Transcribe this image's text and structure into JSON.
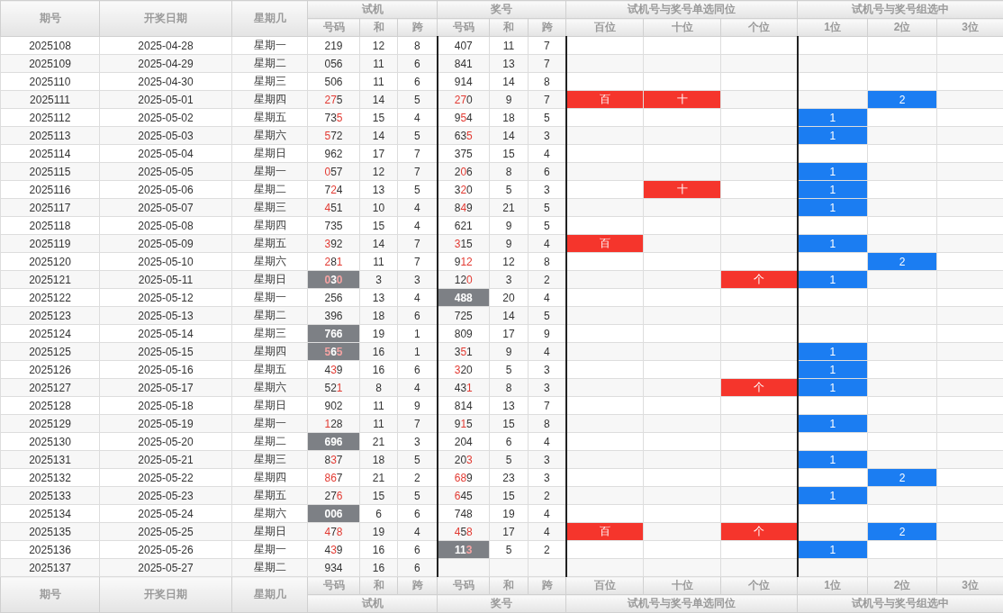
{
  "header": {
    "columns": [
      "期号",
      "开奖日期",
      "星期几"
    ],
    "groups": [
      {
        "title": "试机",
        "subs": [
          "号码",
          "和",
          "跨"
        ]
      },
      {
        "title": "奖号",
        "subs": [
          "号码",
          "和",
          "跨"
        ]
      },
      {
        "title": "试机号与奖号单选同位",
        "subs": [
          "百位",
          "十位",
          "个位"
        ]
      },
      {
        "title": "试机号与奖号组选中",
        "subs": [
          "1位",
          "2位",
          "3位"
        ]
      }
    ]
  },
  "rows": [
    {
      "issue": "2025108",
      "date": "2025-04-28",
      "weekday": "星期一",
      "trial": {
        "number": "219",
        "hits": [
          false,
          false,
          false
        ],
        "shaded": false,
        "sum": "12",
        "span": "8"
      },
      "draw": {
        "number": "407",
        "hits": [
          false,
          false,
          false
        ],
        "shaded": false,
        "sum": "11",
        "span": "7"
      },
      "same_position": {},
      "group_hit": {}
    },
    {
      "issue": "2025109",
      "date": "2025-04-29",
      "weekday": "星期二",
      "trial": {
        "number": "056",
        "hits": [
          false,
          false,
          false
        ],
        "shaded": false,
        "sum": "11",
        "span": "6"
      },
      "draw": {
        "number": "841",
        "hits": [
          false,
          false,
          false
        ],
        "shaded": false,
        "sum": "13",
        "span": "7"
      },
      "same_position": {},
      "group_hit": {}
    },
    {
      "issue": "2025110",
      "date": "2025-04-30",
      "weekday": "星期三",
      "trial": {
        "number": "506",
        "hits": [
          false,
          false,
          false
        ],
        "shaded": false,
        "sum": "11",
        "span": "6"
      },
      "draw": {
        "number": "914",
        "hits": [
          false,
          false,
          false
        ],
        "shaded": false,
        "sum": "14",
        "span": "8"
      },
      "same_position": {},
      "group_hit": {}
    },
    {
      "issue": "2025111",
      "date": "2025-05-01",
      "weekday": "星期四",
      "trial": {
        "number": "275",
        "hits": [
          true,
          true,
          false
        ],
        "shaded": false,
        "sum": "14",
        "span": "5"
      },
      "draw": {
        "number": "270",
        "hits": [
          true,
          true,
          false
        ],
        "shaded": false,
        "sum": "9",
        "span": "7"
      },
      "same_position": {
        "hundreds": "百",
        "tens": "十"
      },
      "group_hit": {
        "second": "2"
      }
    },
    {
      "issue": "2025112",
      "date": "2025-05-02",
      "weekday": "星期五",
      "trial": {
        "number": "735",
        "hits": [
          false,
          false,
          true
        ],
        "shaded": false,
        "sum": "15",
        "span": "4"
      },
      "draw": {
        "number": "954",
        "hits": [
          false,
          true,
          false
        ],
        "shaded": false,
        "sum": "18",
        "span": "5"
      },
      "same_position": {},
      "group_hit": {
        "first": "1"
      }
    },
    {
      "issue": "2025113",
      "date": "2025-05-03",
      "weekday": "星期六",
      "trial": {
        "number": "572",
        "hits": [
          true,
          false,
          false
        ],
        "shaded": false,
        "sum": "14",
        "span": "5"
      },
      "draw": {
        "number": "635",
        "hits": [
          false,
          false,
          true
        ],
        "shaded": false,
        "sum": "14",
        "span": "3"
      },
      "same_position": {},
      "group_hit": {
        "first": "1"
      }
    },
    {
      "issue": "2025114",
      "date": "2025-05-04",
      "weekday": "星期日",
      "trial": {
        "number": "962",
        "hits": [
          false,
          false,
          false
        ],
        "shaded": false,
        "sum": "17",
        "span": "7"
      },
      "draw": {
        "number": "375",
        "hits": [
          false,
          false,
          false
        ],
        "shaded": false,
        "sum": "15",
        "span": "4"
      },
      "same_position": {},
      "group_hit": {}
    },
    {
      "issue": "2025115",
      "date": "2025-05-05",
      "weekday": "星期一",
      "trial": {
        "number": "057",
        "hits": [
          true,
          false,
          false
        ],
        "shaded": false,
        "sum": "12",
        "span": "7"
      },
      "draw": {
        "number": "206",
        "hits": [
          false,
          true,
          false
        ],
        "shaded": false,
        "sum": "8",
        "span": "6"
      },
      "same_position": {},
      "group_hit": {
        "first": "1"
      }
    },
    {
      "issue": "2025116",
      "date": "2025-05-06",
      "weekday": "星期二",
      "trial": {
        "number": "724",
        "hits": [
          false,
          true,
          false
        ],
        "shaded": false,
        "sum": "13",
        "span": "5"
      },
      "draw": {
        "number": "320",
        "hits": [
          false,
          true,
          false
        ],
        "shaded": false,
        "sum": "5",
        "span": "3"
      },
      "same_position": {
        "tens": "十"
      },
      "group_hit": {
        "first": "1"
      }
    },
    {
      "issue": "2025117",
      "date": "2025-05-07",
      "weekday": "星期三",
      "trial": {
        "number": "451",
        "hits": [
          true,
          false,
          false
        ],
        "shaded": false,
        "sum": "10",
        "span": "4"
      },
      "draw": {
        "number": "849",
        "hits": [
          false,
          true,
          false
        ],
        "shaded": false,
        "sum": "21",
        "span": "5"
      },
      "same_position": {},
      "group_hit": {
        "first": "1"
      }
    },
    {
      "issue": "2025118",
      "date": "2025-05-08",
      "weekday": "星期四",
      "trial": {
        "number": "735",
        "hits": [
          false,
          false,
          false
        ],
        "shaded": false,
        "sum": "15",
        "span": "4"
      },
      "draw": {
        "number": "621",
        "hits": [
          false,
          false,
          false
        ],
        "shaded": false,
        "sum": "9",
        "span": "5"
      },
      "same_position": {},
      "group_hit": {}
    },
    {
      "issue": "2025119",
      "date": "2025-05-09",
      "weekday": "星期五",
      "trial": {
        "number": "392",
        "hits": [
          true,
          false,
          false
        ],
        "shaded": false,
        "sum": "14",
        "span": "7"
      },
      "draw": {
        "number": "315",
        "hits": [
          true,
          false,
          false
        ],
        "shaded": false,
        "sum": "9",
        "span": "4"
      },
      "same_position": {
        "hundreds": "百"
      },
      "group_hit": {
        "first": "1"
      }
    },
    {
      "issue": "2025120",
      "date": "2025-05-10",
      "weekday": "星期六",
      "trial": {
        "number": "281",
        "hits": [
          true,
          false,
          true
        ],
        "shaded": false,
        "sum": "11",
        "span": "7"
      },
      "draw": {
        "number": "912",
        "hits": [
          false,
          true,
          true
        ],
        "shaded": false,
        "sum": "12",
        "span": "8"
      },
      "same_position": {},
      "group_hit": {
        "second": "2"
      }
    },
    {
      "issue": "2025121",
      "date": "2025-05-11",
      "weekday": "星期日",
      "trial": {
        "number": "030",
        "hits": [
          true,
          false,
          true
        ],
        "shaded": true,
        "sum": "3",
        "span": "3"
      },
      "draw": {
        "number": "120",
        "hits": [
          false,
          false,
          true
        ],
        "shaded": false,
        "sum": "3",
        "span": "2"
      },
      "same_position": {
        "units": "个"
      },
      "group_hit": {
        "first": "1"
      }
    },
    {
      "issue": "2025122",
      "date": "2025-05-12",
      "weekday": "星期一",
      "trial": {
        "number": "256",
        "hits": [
          false,
          false,
          false
        ],
        "shaded": false,
        "sum": "13",
        "span": "4"
      },
      "draw": {
        "number": "488",
        "hits": [
          false,
          false,
          false
        ],
        "shaded": true,
        "sum": "20",
        "span": "4"
      },
      "same_position": {},
      "group_hit": {}
    },
    {
      "issue": "2025123",
      "date": "2025-05-13",
      "weekday": "星期二",
      "trial": {
        "number": "396",
        "hits": [
          false,
          false,
          false
        ],
        "shaded": false,
        "sum": "18",
        "span": "6"
      },
      "draw": {
        "number": "725",
        "hits": [
          false,
          false,
          false
        ],
        "shaded": false,
        "sum": "14",
        "span": "5"
      },
      "same_position": {},
      "group_hit": {}
    },
    {
      "issue": "2025124",
      "date": "2025-05-14",
      "weekday": "星期三",
      "trial": {
        "number": "766",
        "hits": [
          false,
          false,
          false
        ],
        "shaded": true,
        "sum": "19",
        "span": "1"
      },
      "draw": {
        "number": "809",
        "hits": [
          false,
          false,
          false
        ],
        "shaded": false,
        "sum": "17",
        "span": "9"
      },
      "same_position": {},
      "group_hit": {}
    },
    {
      "issue": "2025125",
      "date": "2025-05-15",
      "weekday": "星期四",
      "trial": {
        "number": "565",
        "hits": [
          true,
          false,
          true
        ],
        "shaded": true,
        "sum": "16",
        "span": "1"
      },
      "draw": {
        "number": "351",
        "hits": [
          false,
          true,
          false
        ],
        "shaded": false,
        "sum": "9",
        "span": "4"
      },
      "same_position": {},
      "group_hit": {
        "first": "1"
      }
    },
    {
      "issue": "2025126",
      "date": "2025-05-16",
      "weekday": "星期五",
      "trial": {
        "number": "439",
        "hits": [
          false,
          true,
          false
        ],
        "shaded": false,
        "sum": "16",
        "span": "6"
      },
      "draw": {
        "number": "320",
        "hits": [
          true,
          false,
          false
        ],
        "shaded": false,
        "sum": "5",
        "span": "3"
      },
      "same_position": {},
      "group_hit": {
        "first": "1"
      }
    },
    {
      "issue": "2025127",
      "date": "2025-05-17",
      "weekday": "星期六",
      "trial": {
        "number": "521",
        "hits": [
          false,
          false,
          true
        ],
        "shaded": false,
        "sum": "8",
        "span": "4"
      },
      "draw": {
        "number": "431",
        "hits": [
          false,
          false,
          true
        ],
        "shaded": false,
        "sum": "8",
        "span": "3"
      },
      "same_position": {
        "units": "个"
      },
      "group_hit": {
        "first": "1"
      }
    },
    {
      "issue": "2025128",
      "date": "2025-05-18",
      "weekday": "星期日",
      "trial": {
        "number": "902",
        "hits": [
          false,
          false,
          false
        ],
        "shaded": false,
        "sum": "11",
        "span": "9"
      },
      "draw": {
        "number": "814",
        "hits": [
          false,
          false,
          false
        ],
        "shaded": false,
        "sum": "13",
        "span": "7"
      },
      "same_position": {},
      "group_hit": {}
    },
    {
      "issue": "2025129",
      "date": "2025-05-19",
      "weekday": "星期一",
      "trial": {
        "number": "128",
        "hits": [
          true,
          false,
          false
        ],
        "shaded": false,
        "sum": "11",
        "span": "7"
      },
      "draw": {
        "number": "915",
        "hits": [
          false,
          true,
          false
        ],
        "shaded": false,
        "sum": "15",
        "span": "8"
      },
      "same_position": {},
      "group_hit": {
        "first": "1"
      }
    },
    {
      "issue": "2025130",
      "date": "2025-05-20",
      "weekday": "星期二",
      "trial": {
        "number": "696",
        "hits": [
          false,
          false,
          false
        ],
        "shaded": true,
        "sum": "21",
        "span": "3"
      },
      "draw": {
        "number": "204",
        "hits": [
          false,
          false,
          false
        ],
        "shaded": false,
        "sum": "6",
        "span": "4"
      },
      "same_position": {},
      "group_hit": {}
    },
    {
      "issue": "2025131",
      "date": "2025-05-21",
      "weekday": "星期三",
      "trial": {
        "number": "837",
        "hits": [
          false,
          true,
          false
        ],
        "shaded": false,
        "sum": "18",
        "span": "5"
      },
      "draw": {
        "number": "203",
        "hits": [
          false,
          false,
          true
        ],
        "shaded": false,
        "sum": "5",
        "span": "3"
      },
      "same_position": {},
      "group_hit": {
        "first": "1"
      }
    },
    {
      "issue": "2025132",
      "date": "2025-05-22",
      "weekday": "星期四",
      "trial": {
        "number": "867",
        "hits": [
          true,
          true,
          false
        ],
        "shaded": false,
        "sum": "21",
        "span": "2"
      },
      "draw": {
        "number": "689",
        "hits": [
          true,
          true,
          false
        ],
        "shaded": false,
        "sum": "23",
        "span": "3"
      },
      "same_position": {},
      "group_hit": {
        "second": "2"
      }
    },
    {
      "issue": "2025133",
      "date": "2025-05-23",
      "weekday": "星期五",
      "trial": {
        "number": "276",
        "hits": [
          false,
          false,
          true
        ],
        "shaded": false,
        "sum": "15",
        "span": "5"
      },
      "draw": {
        "number": "645",
        "hits": [
          true,
          false,
          false
        ],
        "shaded": false,
        "sum": "15",
        "span": "2"
      },
      "same_position": {},
      "group_hit": {
        "first": "1"
      }
    },
    {
      "issue": "2025134",
      "date": "2025-05-24",
      "weekday": "星期六",
      "trial": {
        "number": "006",
        "hits": [
          false,
          false,
          false
        ],
        "shaded": true,
        "sum": "6",
        "span": "6"
      },
      "draw": {
        "number": "748",
        "hits": [
          false,
          false,
          false
        ],
        "shaded": false,
        "sum": "19",
        "span": "4"
      },
      "same_position": {},
      "group_hit": {}
    },
    {
      "issue": "2025135",
      "date": "2025-05-25",
      "weekday": "星期日",
      "trial": {
        "number": "478",
        "hits": [
          true,
          false,
          true
        ],
        "shaded": false,
        "sum": "19",
        "span": "4"
      },
      "draw": {
        "number": "458",
        "hits": [
          true,
          false,
          true
        ],
        "shaded": false,
        "sum": "17",
        "span": "4"
      },
      "same_position": {
        "hundreds": "百",
        "units": "个"
      },
      "group_hit": {
        "second": "2"
      }
    },
    {
      "issue": "2025136",
      "date": "2025-05-26",
      "weekday": "星期一",
      "trial": {
        "number": "439",
        "hits": [
          false,
          true,
          false
        ],
        "shaded": false,
        "sum": "16",
        "span": "6"
      },
      "draw": {
        "number": "113",
        "hits": [
          false,
          false,
          true
        ],
        "shaded": true,
        "sum": "5",
        "span": "2"
      },
      "same_position": {},
      "group_hit": {
        "first": "1"
      }
    },
    {
      "issue": "2025137",
      "date": "2025-05-27",
      "weekday": "星期二",
      "trial": {
        "number": "934",
        "hits": [
          false,
          false,
          false
        ],
        "shaded": false,
        "sum": "16",
        "span": "6"
      },
      "same_position": {},
      "group_hit": {}
    }
  ],
  "footer": {
    "columns": [
      "期号",
      "开奖日期",
      "星期几"
    ],
    "groups": [
      {
        "title": "试机",
        "subs": [
          "号码",
          "和",
          "跨"
        ]
      },
      {
        "title": "奖号",
        "subs": [
          "号码",
          "和",
          "跨"
        ]
      },
      {
        "title": "试机号与奖号单选同位",
        "subs": [
          "百位",
          "十位",
          "个位"
        ]
      },
      {
        "title": "试机号与奖号组选中",
        "subs": [
          "1位",
          "2位",
          "3位"
        ]
      }
    ]
  }
}
